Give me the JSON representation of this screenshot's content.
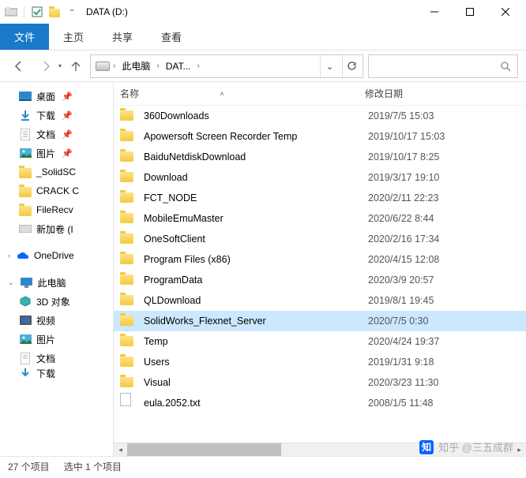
{
  "window": {
    "title": "DATA (D:)"
  },
  "ribbon": {
    "file": "文件",
    "home": "主页",
    "share": "共享",
    "view": "查看"
  },
  "address": {
    "crumb1": "此电脑",
    "crumb2": "DAT..."
  },
  "columns": {
    "name": "名称",
    "date": "修改日期"
  },
  "nav": {
    "desktop": "桌面",
    "downloads": "下载",
    "documents": "文档",
    "pictures": "图片",
    "solidsc": "_SolidSC",
    "crack": "CRACK C",
    "filerecv": "FileRecv",
    "newvol": "新加卷 (I",
    "onedrive": "OneDrive",
    "thispc": "此电脑",
    "objects3d": "3D 对象",
    "videos": "视频",
    "pictures2": "图片",
    "documents2": "文档",
    "downloads2": "下载"
  },
  "files": [
    {
      "name": "360Downloads",
      "date": "2019/7/5 15:03",
      "type": "folder"
    },
    {
      "name": "Apowersoft Screen Recorder Temp",
      "date": "2019/10/17 15:03",
      "type": "folder"
    },
    {
      "name": "BaiduNetdiskDownload",
      "date": "2019/10/17 8:25",
      "type": "folder"
    },
    {
      "name": "Download",
      "date": "2019/3/17 19:10",
      "type": "folder"
    },
    {
      "name": "FCT_NODE",
      "date": "2020/2/11 22:23",
      "type": "folder"
    },
    {
      "name": "MobileEmuMaster",
      "date": "2020/6/22 8:44",
      "type": "folder"
    },
    {
      "name": "OneSoftClient",
      "date": "2020/2/16 17:34",
      "type": "folder"
    },
    {
      "name": "Program Files (x86)",
      "date": "2020/4/15 12:08",
      "type": "folder"
    },
    {
      "name": "ProgramData",
      "date": "2020/3/9 20:57",
      "type": "folder"
    },
    {
      "name": "QLDownload",
      "date": "2019/8/1 19:45",
      "type": "folder"
    },
    {
      "name": "SolidWorks_Flexnet_Server",
      "date": "2020/7/5 0:30",
      "type": "folder",
      "selected": true
    },
    {
      "name": "Temp",
      "date": "2020/4/24 19:37",
      "type": "folder"
    },
    {
      "name": "Users",
      "date": "2019/1/31 9:18",
      "type": "folder"
    },
    {
      "name": "Visual",
      "date": "2020/3/23 11:30",
      "type": "folder"
    },
    {
      "name": "eula.2052.txt",
      "date": "2008/1/5 11:48",
      "type": "file"
    }
  ],
  "status": {
    "count": "27 个项目",
    "selected": "选中 1 个项目"
  },
  "watermark": {
    "brand": "知",
    "text": "知乎 @三五成群"
  }
}
